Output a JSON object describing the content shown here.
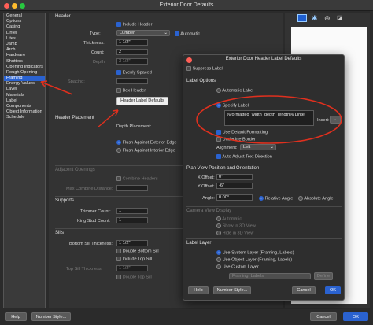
{
  "window": {
    "title": "Exterior Door Defaults"
  },
  "sidebar": {
    "items": [
      {
        "label": "General"
      },
      {
        "label": "Options"
      },
      {
        "label": "Casing"
      },
      {
        "label": "Lintel"
      },
      {
        "label": "Lites"
      },
      {
        "label": "Jamb"
      },
      {
        "label": "Arch"
      },
      {
        "label": "Hardware"
      },
      {
        "label": "Shutters"
      },
      {
        "label": "Opening Indicators"
      },
      {
        "label": "Rough Opening"
      },
      {
        "label": "Framing",
        "selected": true
      },
      {
        "label": "Energy Values"
      },
      {
        "label": "Layer"
      },
      {
        "label": "Materials"
      },
      {
        "label": "Label"
      },
      {
        "label": "Components"
      },
      {
        "label": "Object Information"
      },
      {
        "label": "Schedule"
      }
    ]
  },
  "header": {
    "section": "Header",
    "include_header": "Include Header",
    "type_label": "Type:",
    "type_value": "Lumber",
    "automatic": "Automatic",
    "thickness_label": "Thickness:",
    "thickness_value": "1 1/2\"",
    "count_label": "Count:",
    "count_value": "2",
    "depth_label": "Depth:",
    "depth_value": "3 1/2\"",
    "evenly_spaced": "Evenly Spaced",
    "spacing_label": "Spacing:",
    "box_header": "Box Header",
    "label_defaults_button": "Header Label Defaults"
  },
  "placement": {
    "section": "Header Placement",
    "depth_placement": "Depth Placement:",
    "flush_exterior": "Flush Against Exterior Edge",
    "flush_interior": "Flush Against Interior Edge"
  },
  "adjacent": {
    "section": "Adjacent Openings",
    "combine": "Combine Headers",
    "max_combine": "Max Combine Distance:"
  },
  "supports": {
    "section": "Supports",
    "trimmer_label": "Trimmer Count:",
    "trimmer_value": "1",
    "king_label": "King Stud Count:",
    "king_value": "1"
  },
  "sills": {
    "section": "Sills",
    "bottom_label": "Bottom Sill Thickness:",
    "bottom_value": "1 1/2\"",
    "double_bottom": "Double Bottom Sill",
    "include_top": "Include Top Sill",
    "top_label": "Top Sill Thickness:",
    "top_value": "1 1/2\"",
    "double_top": "Double Top Sill"
  },
  "dialog": {
    "title": "Exterior Door Header Label Defaults",
    "suppress": "Suppress Label",
    "label_options": "Label Options",
    "automatic_label": "Automatic Label",
    "specify_label": "Specify Label",
    "label_text": "%formatted_width_depth_length% Lintel",
    "insert": "Insert:",
    "use_default_formatting": "Use Default Formatting",
    "underline_border": "Underline Border",
    "alignment_label": "Alignment:",
    "alignment_value": "Left",
    "auto_adjust": "Auto Adjust Text Direction",
    "plan_view": "Plan View Position and Orientation",
    "x_offset_label": "X Offset:",
    "x_offset_value": "0\"",
    "y_offset_label": "Y Offset:",
    "y_offset_value": "-6\"",
    "angle_label": "Angle:",
    "angle_value": "0.00°",
    "relative_angle": "Relative Angle",
    "absolute_angle": "Absolute Angle",
    "camera_display": "Camera View Display",
    "cam_automatic": "Automatic",
    "cam_plan": "Show in 3D View",
    "cam_hide": "Hide in 3D View",
    "label_layer": "Label Layer",
    "use_system_layer": "Use System Layer (Framing, Labels)",
    "use_object_layer": "Use Object Layer (Framing, Labels)",
    "use_custom_layer": "Use Custom Layer",
    "layer_value": "Framing, Labels",
    "define": "Define",
    "help": "Help",
    "number_style": "Number Style...",
    "cancel": "Cancel",
    "ok": "OK"
  },
  "footer": {
    "help": "Help",
    "number_style": "Number Style...",
    "cancel": "Cancel",
    "ok": "OK"
  },
  "colors": {
    "accent": "#2a62d0",
    "annotation": "#e0301e"
  }
}
